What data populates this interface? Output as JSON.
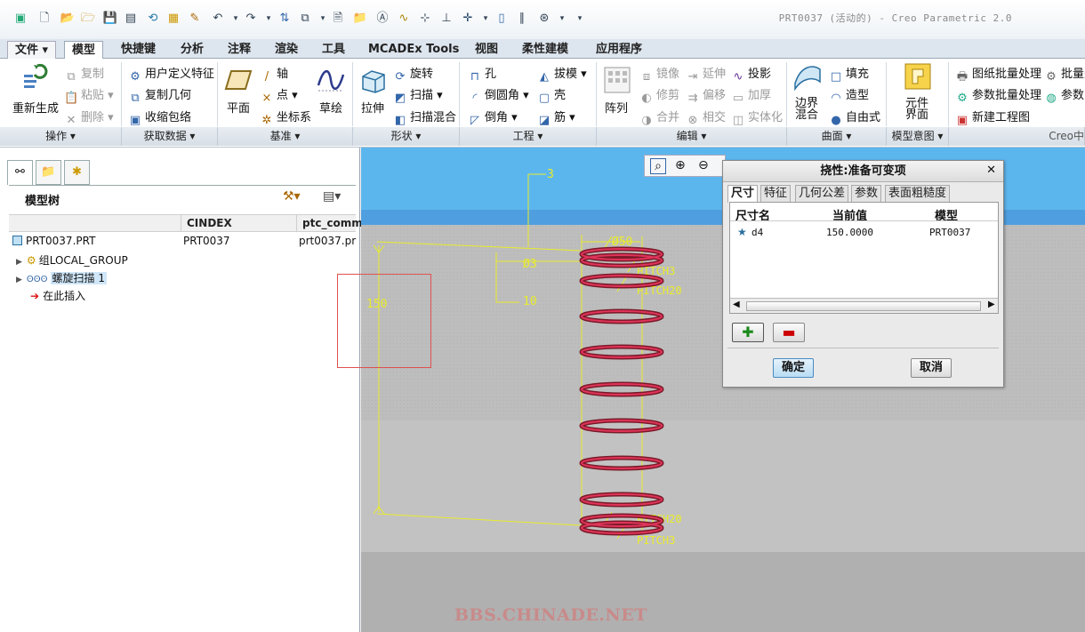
{
  "window": {
    "title": "PRT0037 (活动的) - Creo Parametric 2.0"
  },
  "quick_toolbar": {
    "icons": [
      "creo-logo-icon",
      "new-file-icon",
      "open-folder-icon",
      "save-icon",
      "save-copy-icon",
      "regenerate-icon",
      "window-icon",
      "undo-icon",
      "redo-icon",
      "group-icon",
      "windows-icon",
      "text-icon",
      "folder-icon",
      "annotation-icon",
      "curve-icon",
      "point-icon",
      "plane-icon",
      "axis-icon",
      "coord-icon",
      "datum-icon",
      "style-icon",
      "more-icon"
    ]
  },
  "tabs": [
    {
      "label": "文件 ▾"
    },
    {
      "label": "模型"
    },
    {
      "label": "快捷键"
    },
    {
      "label": "分析"
    },
    {
      "label": "注释"
    },
    {
      "label": "渲染"
    },
    {
      "label": "工具"
    },
    {
      "label": "MCADEx Tools"
    },
    {
      "label": "视图"
    },
    {
      "label": "柔性建模"
    },
    {
      "label": "应用程序"
    }
  ],
  "ribbon": {
    "operations": {
      "regen": "重新生成",
      "copy": "复制",
      "paste": "粘贴",
      "delete": "删除",
      "group": "操作"
    },
    "getdata": {
      "udf": "用户定义特征",
      "copygeom": "复制几何",
      "shrink": "收缩包络",
      "group": "获取数据"
    },
    "datum": {
      "plane": "平面",
      "axis": "轴",
      "point": "点",
      "csys": "坐标系",
      "sketch": "草绘",
      "group": "基准"
    },
    "shapes": {
      "extrude": "拉伸",
      "revolve": "旋转",
      "sweep": "扫描",
      "sweepblend": "扫描混合",
      "group": "形状"
    },
    "engineering": {
      "hole": "孔",
      "round": "倒圆角",
      "chamfer": "倒角",
      "draft": "拔模",
      "shell": "壳",
      "rib": "筋",
      "group": "工程"
    },
    "editing": {
      "pattern": "阵列",
      "mirror": "镜像",
      "trim": "修剪",
      "merge": "合并",
      "extend": "延伸",
      "offset": "偏移",
      "intersect": "相交",
      "project": "投影",
      "thicken": "加厚",
      "solidify": "实体化",
      "group": "编辑"
    },
    "surfaces": {
      "boundary": "边界\n混合",
      "fill": "填充",
      "style": "造型",
      "freestyle": "自由式",
      "group": "曲面"
    },
    "intent": {
      "component": "元件\n界面",
      "group": "模型意图"
    },
    "batch": {
      "drawing": "图纸批量处理",
      "param": "参数批量处理",
      "newdrawing": "新建工程图",
      "batch2": "批量处",
      "param2": "参数",
      "group": "Creo中"
    }
  },
  "model_tree": {
    "title": "模型树",
    "columns": [
      "CINDEX",
      "ptc_comm"
    ],
    "rows": [
      {
        "name": "PRT0037.PRT",
        "cindex": "PRT0037",
        "comment": "prt0037.pr"
      },
      {
        "name": "组LOCAL_GROUP",
        "cindex": "",
        "comment": ""
      },
      {
        "name": "螺旋扫描 1",
        "cindex": "",
        "comment": ""
      },
      {
        "name": "在此插入",
        "cindex": "",
        "comment": ""
      }
    ]
  },
  "annotations": {
    "dim_3": "3",
    "dim_d3": "Ø3",
    "dim_10": "10",
    "dim_150": "150",
    "dim_d50": "Ø50",
    "pitch3_top": "PITCH3",
    "pitch20_top": "PITCH20",
    "pitch20_bot": "PITCH20",
    "pitch3_bot": "PITCH3"
  },
  "dialog": {
    "title": "挠性:准备可变项",
    "tabs": [
      "尺寸",
      "特征",
      "几何公差",
      "参数",
      "表面粗糙度"
    ],
    "columns": [
      "尺寸名",
      "当前值",
      "模型"
    ],
    "rows": [
      {
        "name": "d4",
        "value": "150.0000",
        "model": "PRT0037"
      }
    ],
    "ok": "确定",
    "cancel": "取消"
  },
  "watermark": "BBS.CHINADE.NET"
}
